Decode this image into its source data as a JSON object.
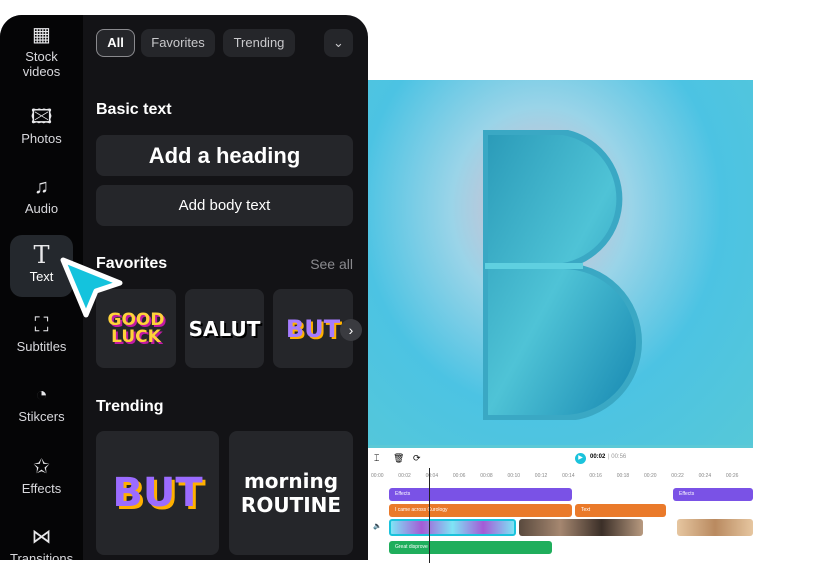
{
  "sidebar": {
    "items": [
      {
        "label": "Stock videos",
        "icon": "film-icon"
      },
      {
        "label": "Photos",
        "icon": "image-icon"
      },
      {
        "label": "Audio",
        "icon": "music-icon"
      },
      {
        "label": "Text",
        "icon": "text-icon",
        "active": true
      },
      {
        "label": "Subtitles",
        "icon": "subtitles-icon"
      },
      {
        "label": "Stikcers",
        "icon": "sticker-icon"
      },
      {
        "label": "Effects",
        "icon": "sparkle-icon"
      },
      {
        "label": "Transitions",
        "icon": "transition-icon"
      }
    ]
  },
  "filters": {
    "chips": [
      "All",
      "Favorites",
      "Trending"
    ],
    "selected": "All"
  },
  "basic": {
    "title": "Basic text",
    "heading": "Add a heading",
    "body": "Add body text"
  },
  "favorites": {
    "title": "Favorites",
    "see_all": "See all",
    "stickers": [
      "GOOD LUCK",
      "SALUT",
      "BUT"
    ]
  },
  "trending": {
    "title": "Trending",
    "stickers": [
      "BUT",
      "morning ROUTINE"
    ]
  },
  "timeline": {
    "current": "00:02",
    "total": "00:56",
    "ticks": [
      "00:00",
      "00:02",
      "00:04",
      "00:06",
      "00:08",
      "00:10",
      "00:12",
      "00:14",
      "00:16",
      "00:18",
      "00:20",
      "00:22",
      "00:24",
      "00:26"
    ],
    "effects": [
      "Effects",
      "Effects"
    ],
    "texts": [
      "I came across Curology",
      "Text"
    ],
    "audio": "Great disprove"
  },
  "colors": {
    "accent": "#1bc3dc",
    "effects": "#7a52e6",
    "text_track": "#ea7a2a",
    "audio_track": "#1fae5c"
  }
}
